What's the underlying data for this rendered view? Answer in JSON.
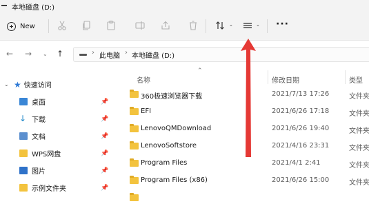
{
  "window": {
    "title": "本地磁盘 (D:)"
  },
  "toolbar": {
    "new_label": "New",
    "icons": [
      "cut-icon",
      "copy-icon",
      "paste-icon",
      "rename-icon",
      "share-icon",
      "delete-icon",
      "sort-icon",
      "view-icon",
      "more-icon"
    ]
  },
  "address": {
    "breadcrumbs": [
      "此电脑",
      "本地磁盘 (D:)"
    ]
  },
  "sidebar": {
    "quick_access": "快速访问",
    "items": [
      {
        "label": "桌面",
        "icon": "desktop-icon"
      },
      {
        "label": "下载",
        "icon": "download-icon"
      },
      {
        "label": "文档",
        "icon": "document-icon"
      },
      {
        "label": "WPS网盘",
        "icon": "folder-icon"
      },
      {
        "label": "图片",
        "icon": "picture-icon"
      },
      {
        "label": "示例文件夹",
        "icon": "folder-icon"
      }
    ]
  },
  "columns": {
    "name": "名称",
    "date": "修改日期",
    "type": "类型"
  },
  "files": [
    {
      "name": "360极速浏览器下载",
      "date": "2021/7/13 17:26",
      "type": "文件夹"
    },
    {
      "name": "EFI",
      "date": "2021/6/26 17:18",
      "type": "文件夹"
    },
    {
      "name": "LenovoQMDownload",
      "date": "2021/6/26 19:40",
      "type": "文件夹"
    },
    {
      "name": "LenovoSoftstore",
      "date": "2021/4/16 23:31",
      "type": "文件夹"
    },
    {
      "name": "Program Files",
      "date": "2021/4/1 2:41",
      "type": "文件夹"
    },
    {
      "name": "Program Files (x86)",
      "date": "2021/6/26 15:00",
      "type": "文件夹"
    }
  ],
  "colors": {
    "annotation_arrow": "#e53935",
    "folder": "#f3c33e",
    "accent": "#2f7ad6"
  }
}
